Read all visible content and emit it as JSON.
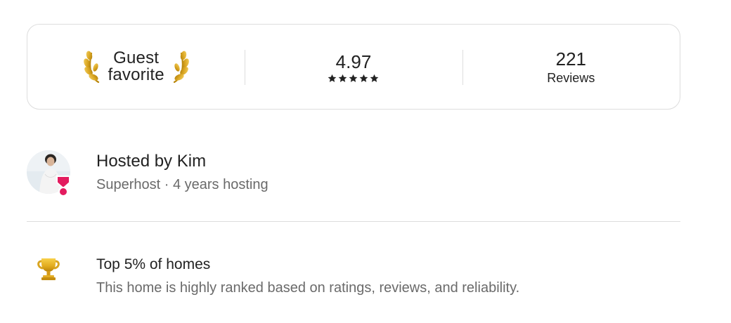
{
  "guest_favorite": {
    "title_line1": "Guest",
    "title_line2": "favorite",
    "rating": "4.97",
    "stars": 5,
    "reviews_count": "221",
    "reviews_label": "Reviews"
  },
  "host": {
    "name": "Hosted by Kim",
    "subtitle": "Superhost · 4 years hosting",
    "badge_color": "#E31C5F"
  },
  "highlight": {
    "icon": "trophy-icon",
    "title": "Top 5% of homes",
    "description": "This home is highly ranked based on ratings, reviews, and reliability."
  },
  "colors": {
    "text_primary": "#222222",
    "text_secondary": "#6A6A6A",
    "border": "#DDDDDD",
    "laurel_gold": "#D4A017"
  }
}
